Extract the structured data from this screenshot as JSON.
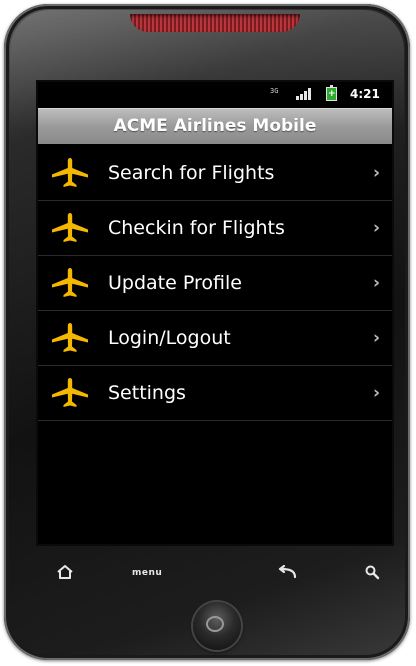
{
  "status_bar": {
    "network_label": "3G",
    "time": "4:21"
  },
  "header": {
    "title": "ACME Airlines Mobile"
  },
  "menu": {
    "items": [
      {
        "label": "Search for Flights",
        "icon": "airplane-icon",
        "chevron": "›"
      },
      {
        "label": "Checkin for Flights",
        "icon": "airplane-icon",
        "chevron": "›"
      },
      {
        "label": "Update Profile",
        "icon": "airplane-icon",
        "chevron": "›"
      },
      {
        "label": "Login/Logout",
        "icon": "airplane-icon",
        "chevron": "›"
      },
      {
        "label": "Settings",
        "icon": "airplane-icon",
        "chevron": "›"
      }
    ]
  },
  "hardware_keys": {
    "home_icon": "home-icon",
    "menu_label": "menu",
    "back_icon": "back-arrow-icon",
    "search_icon": "search-icon"
  },
  "colors": {
    "icon_accent": "#f5b800",
    "title_bar": "#9a9a9a",
    "screen_background": "#000000"
  }
}
